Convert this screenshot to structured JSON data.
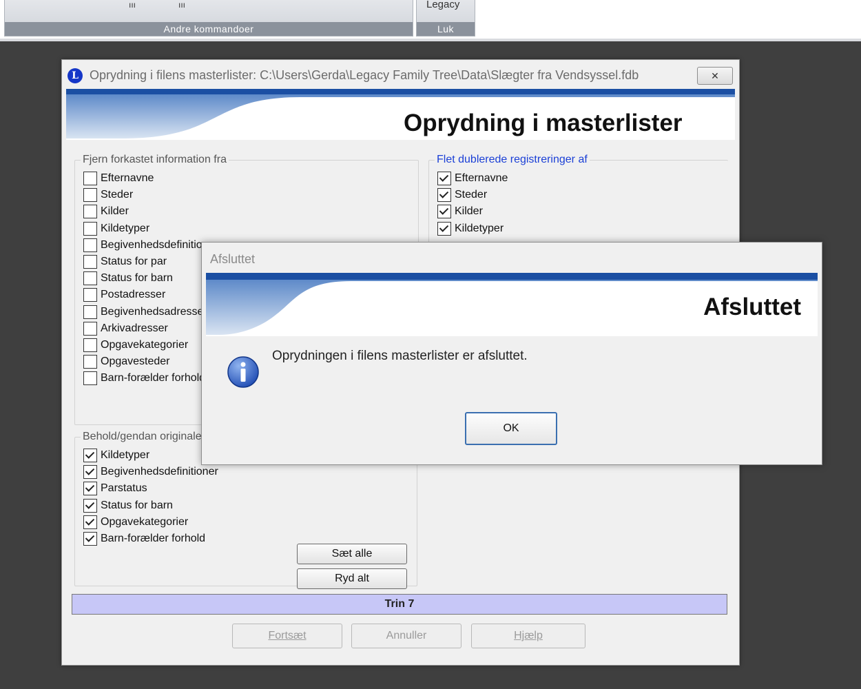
{
  "ribbon": {
    "group_other_label": "Andre kommandoer",
    "group_close_label": "Luk",
    "legacy_fragment": "Legacy"
  },
  "dialog": {
    "title": "Oprydning i filens masterlister: C:\\Users\\Gerda\\Legacy Family Tree\\Data\\Slægter fra Vendsyssel.fdb",
    "close_glyph": "✕",
    "heading": "Oprydning i masterlister",
    "remove_group": {
      "legend": "Fjern forkastet information fra",
      "items": [
        {
          "label": "Efternavne",
          "checked": false
        },
        {
          "label": "Steder",
          "checked": false
        },
        {
          "label": "Kilder",
          "checked": false
        },
        {
          "label": "Kildetyper",
          "checked": false
        },
        {
          "label": "Begivenhedsdefinitioner",
          "checked": false
        },
        {
          "label": "Status for par",
          "checked": false
        },
        {
          "label": "Status for barn",
          "checked": false
        },
        {
          "label": "Postadresser",
          "checked": false
        },
        {
          "label": "Begivenhedsadresser",
          "checked": false
        },
        {
          "label": "Arkivadresser",
          "checked": false
        },
        {
          "label": "Opgavekategorier",
          "checked": false
        },
        {
          "label": "Opgavesteder",
          "checked": false
        },
        {
          "label": "Barn-forælder forhold",
          "checked": false
        }
      ]
    },
    "merge_group": {
      "legend": "Flet dublerede registreringer af",
      "items": [
        {
          "label": "Efternavne",
          "checked": true
        },
        {
          "label": "Steder",
          "checked": true
        },
        {
          "label": "Kilder",
          "checked": true
        },
        {
          "label": "Kildetyper",
          "checked": true
        }
      ]
    },
    "keep_group": {
      "legend": "Behold/gendan originaler",
      "items": [
        {
          "label": "Kildetyper",
          "checked": true
        },
        {
          "label": "Begivenhedsdefinitioner",
          "checked": true
        },
        {
          "label": "Parstatus",
          "checked": true
        },
        {
          "label": "Status for barn",
          "checked": true
        },
        {
          "label": "Opgavekategorier",
          "checked": true
        },
        {
          "label": "Barn-forælder forhold",
          "checked": true
        }
      ],
      "set_all_label": "Sæt alle",
      "clear_all_label": "Ryd alt"
    },
    "step_label": "Trin 7",
    "buttons": {
      "continue_label": "Fortsæt",
      "cancel_label": "Annuller",
      "help_label": "Hjælp"
    }
  },
  "modal": {
    "title": "Afsluttet",
    "heading": "Afsluttet",
    "message": "Oprydningen i filens masterlister er afsluttet.",
    "ok_label": "OK"
  },
  "colors": {
    "banner_blue": "#1b4fa3",
    "step_bar": "#c7c7f7",
    "app_icon": "#1537c8"
  }
}
